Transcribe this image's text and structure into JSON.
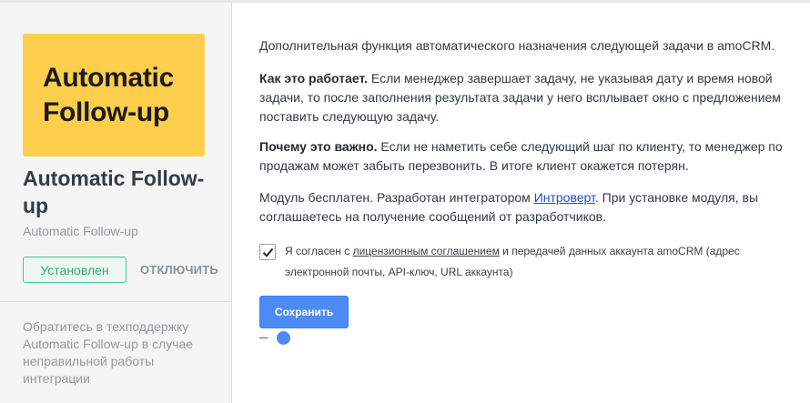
{
  "sidebar": {
    "logo_line1": "Automatic",
    "logo_line2": "Follow-up",
    "title": "Automatic Follow-up",
    "subtitle": "Automatic Follow-up",
    "installed_label": "Установлен",
    "disable_label": "ОТКЛЮЧИТЬ",
    "support_text": "Обратитесь в техподдержку Automatic Follow-up в случае неправильной работы интеграции"
  },
  "main": {
    "intro": "Дополнительная функция автоматического назначения следующей задачи в amoCRM.",
    "how_title": "Как это работает.",
    "how_text": " Если менеджер завершает задачу, не указывая дату и время новой задачи, то после заполнения результата задачи у него всплывает окно с предложением поставить следующую задачу.",
    "why_title": "Почему это важно.",
    "why_text": " Если не наметить себе следующий шаг по клиенту, то менеджер по продажам может забыть перезвонить. В итоге клиент окажется потерян.",
    "module_text_before": "Модуль бесплатен. Разработан интегратором ",
    "developer_link": "Интроверт",
    "module_text_after": ". При установке модуля, вы соглашаетесь на получение сообщений от разработчиков.",
    "agree_before": "Я согласен с ",
    "agree_link": "лицензионным соглашением",
    "agree_after": " и передачей данных аккаунта amoCRM (адрес электронной почты, API-ключ, URL аккаунта)",
    "agree_checked": true,
    "save_label": "Сохранить"
  },
  "colors": {
    "logo_bg": "#ffce4d",
    "installed_green": "#2bac66",
    "save_blue": "#4c8bf5",
    "link_blue": "#1f4cd6"
  },
  "icons": [
    "checkmark-icon"
  ]
}
